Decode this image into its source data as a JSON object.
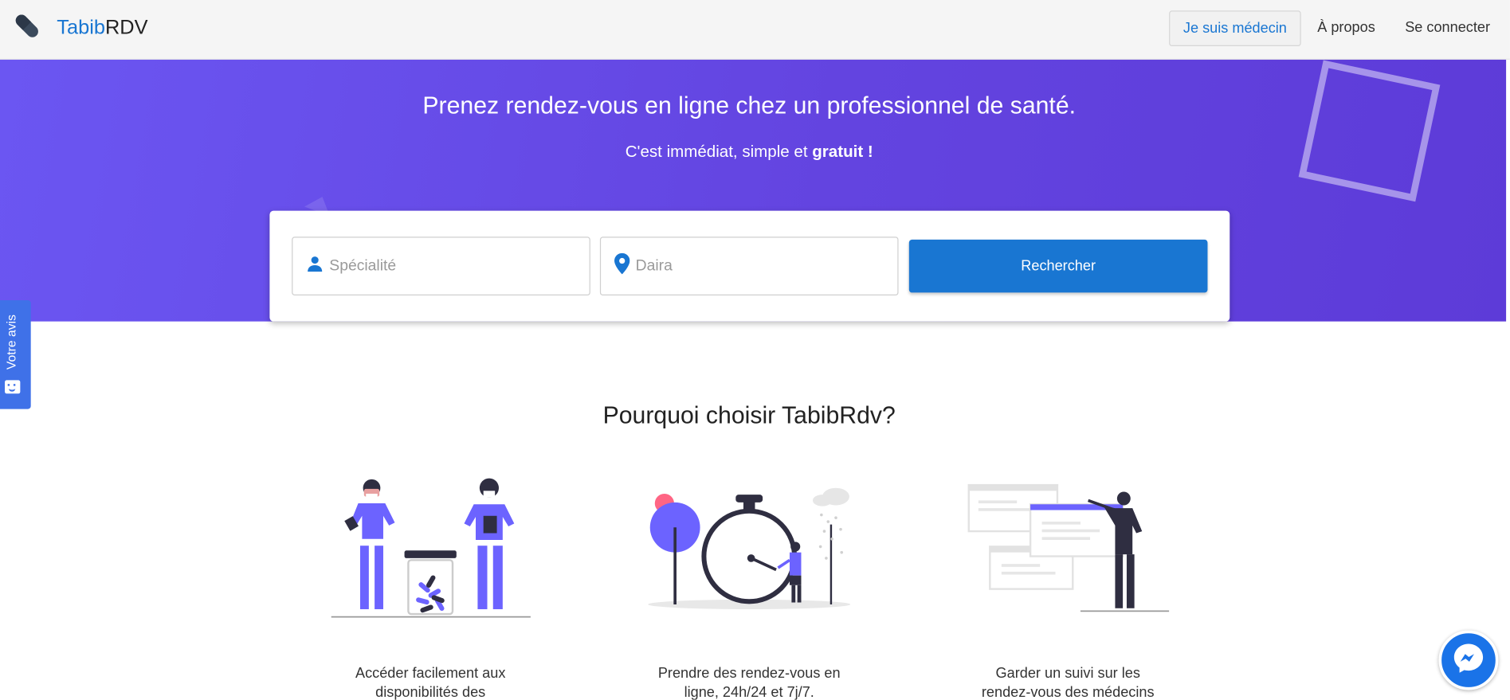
{
  "header": {
    "brand_part1": "Tabib",
    "brand_part2": "RDV",
    "doctor_button": "Je suis médecin",
    "about_link": "À propos",
    "login_link": "Se connecter"
  },
  "hero": {
    "title": "Prenez rendez-vous en ligne chez un professionnel de santé.",
    "subtitle_plain": "C'est immédiat, simple et ",
    "subtitle_bold": "gratuit !"
  },
  "search": {
    "specialty_placeholder": "Spécialité",
    "daira_placeholder": "Daira",
    "button_label": "Rechercher"
  },
  "feedback": {
    "label": "Votre avis"
  },
  "why": {
    "title": "Pourquoi choisir TabibRdv?",
    "features": [
      {
        "text": "Accéder facilement aux disponibilités des"
      },
      {
        "text": "Prendre des rendez-vous en ligne, 24h/24 et 7j/7."
      },
      {
        "text": "Garder un suivi sur les rendez-vous des médecins consultés."
      }
    ]
  },
  "colors": {
    "primary": "#1976d2",
    "hero_gradient_start": "#6b56f2",
    "hero_gradient_end": "#5d3bd8",
    "feedback_tab": "#3f71e8",
    "illustration_accent": "#6c63ff"
  },
  "icons": {
    "brand": "pill-icon",
    "specialty": "person-icon",
    "daira": "map-pin-icon",
    "feedback": "smiley-icon",
    "chat": "messenger-icon"
  }
}
